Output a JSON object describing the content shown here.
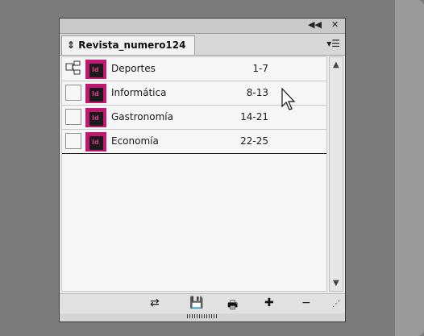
{
  "panel": {
    "tab_label": "Revista_numero124",
    "panel_menu_icon": "panel-menu-icon",
    "controls": [
      "collapse-icon",
      "close-icon"
    ]
  },
  "book_rows": [
    {
      "name": "Deportes",
      "pages": "1-7",
      "style_source": true
    },
    {
      "name": "Informática",
      "pages": "8-13",
      "style_source": false
    },
    {
      "name": "Gastronomía",
      "pages": "14-21",
      "style_source": false
    },
    {
      "name": "Economía",
      "pages": "22-25",
      "style_source": false
    }
  ],
  "icons": {
    "sync_icon": "synchronize-icon",
    "save_icon": "save-icon",
    "print_icon": "print-icon",
    "add_icon": "add-document-icon",
    "remove_icon": "remove-document-icon",
    "resize_icon": "resize-grip-icon"
  },
  "colors": {
    "indesign_pink": "#c21770",
    "panel_bg": "#ececec"
  }
}
